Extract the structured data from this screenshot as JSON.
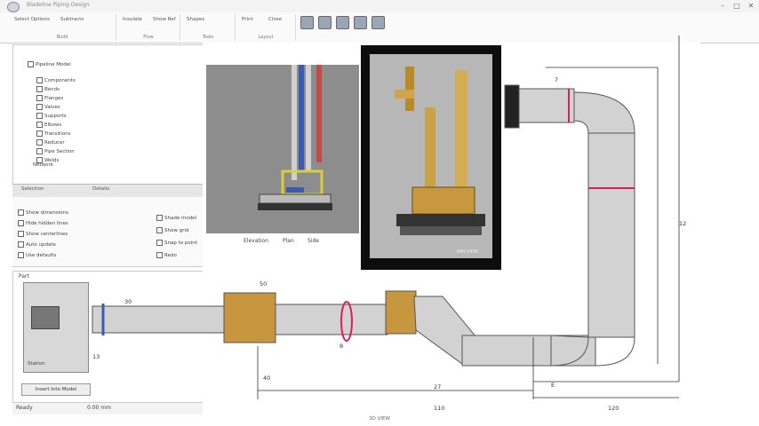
{
  "app": {
    "title": "Bladeline Piping Design"
  },
  "ribbon": {
    "groups": [
      "Build",
      "Flow",
      "Tools",
      "Layout"
    ],
    "buttons": [
      "Select Options",
      "Subtracts",
      "Insulate",
      "Show Ref",
      "Shapes",
      "Print",
      "Close"
    ]
  },
  "tree": {
    "root": "Pipeline Model",
    "items": [
      "Components",
      "Bends",
      "Flanges",
      "Valves",
      "Supports",
      "Elbows",
      "Transitions",
      "Reducer",
      "Pipe Section",
      "Welds"
    ],
    "footer": "Network"
  },
  "tabs": [
    "Selection",
    "Details"
  ],
  "properties": {
    "left": [
      "Show dimensions",
      "Hide hidden lines",
      "Show centerlines",
      "Auto update",
      "Use defaults"
    ],
    "right": [
      "Shade model",
      "Show grid",
      "Snap to point",
      "Redo"
    ]
  },
  "preview": {
    "title": "Part",
    "caption": "Station",
    "button": "Insert Into Model"
  },
  "status": {
    "left": "Ready",
    "right": "0.00 mm"
  },
  "bottom_caption": "3D VIEW",
  "viewport": {
    "shot1_captions": [
      "Elevation",
      "Plan",
      "Side"
    ],
    "shot2_label": "BIM VIEW",
    "dims": {
      "top_label": "7",
      "right_label": "12",
      "bottom_left": "27",
      "bottom_mid": "110",
      "bottom_right": "120",
      "d1": "30",
      "d2": "50",
      "d3": "13",
      "d4": "40",
      "d5": "E",
      "d6": "8"
    }
  },
  "colors": {
    "pipe": "#c9c9c9",
    "pipe_edge": "#555555",
    "flange": "#c8963e",
    "seam": "#d81e5b",
    "ribbon_bg": "#fafafa"
  }
}
